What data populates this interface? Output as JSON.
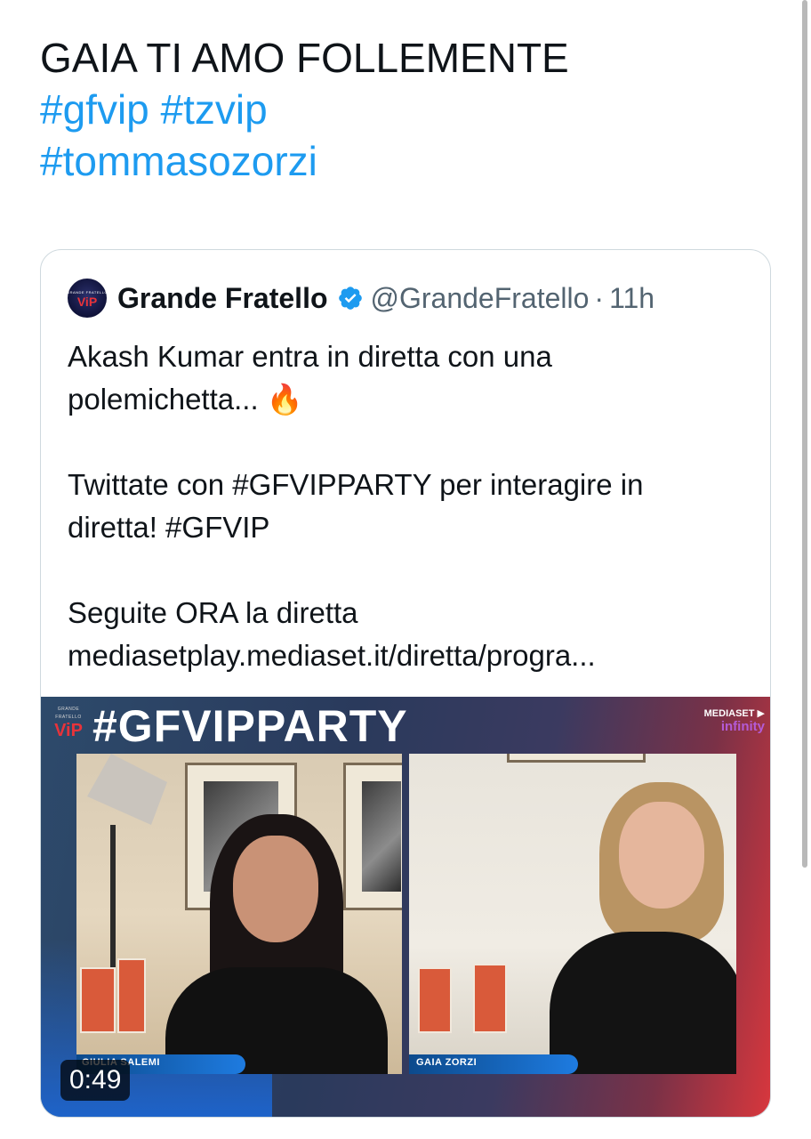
{
  "tweet": {
    "line1": "GAIA TI AMO FOLLEMENTE",
    "hashtags_line2": [
      "#gfvip",
      "#tzvip"
    ],
    "hashtags_line3": [
      "#tommasozorzi"
    ]
  },
  "quoted": {
    "avatar_text_top": "GRANDE FRATELLO",
    "avatar_text_vip": "ViP",
    "display_name": "Grande Fratello",
    "verified": true,
    "handle": "@GrandeFratello",
    "separator": "·",
    "time": "11h",
    "body": {
      "p1_line1": "Akash Kumar entra in diretta con una",
      "p1_line2": "polemichetta... 🔥",
      "p2_line1": "Twittate con #GFVIPPARTY per interagire in",
      "p2_line2": "diretta! #GFVIP",
      "p3_line1": "Seguite ORA la diretta",
      "p3_line2": "mediasetplay.mediaset.it/diretta/progra..."
    },
    "media": {
      "logo_top": "GRANDE FRATELLO",
      "logo_vip": "ViP",
      "title": "#GFVIPPARTY",
      "brand_line1": "MEDIASET ▶",
      "brand_line2": "infinity",
      "left_name": "GIULIA SALEMI",
      "right_name": "GAIA ZORZI",
      "duration": "0:49"
    }
  },
  "colors": {
    "link": "#1d9bf0",
    "text": "#0f1419",
    "secondary": "#536471",
    "border": "#cfd9de",
    "verified": "#1d9bf0"
  },
  "icons": {
    "verified": "verified-badge-icon",
    "fire": "fire-emoji"
  }
}
